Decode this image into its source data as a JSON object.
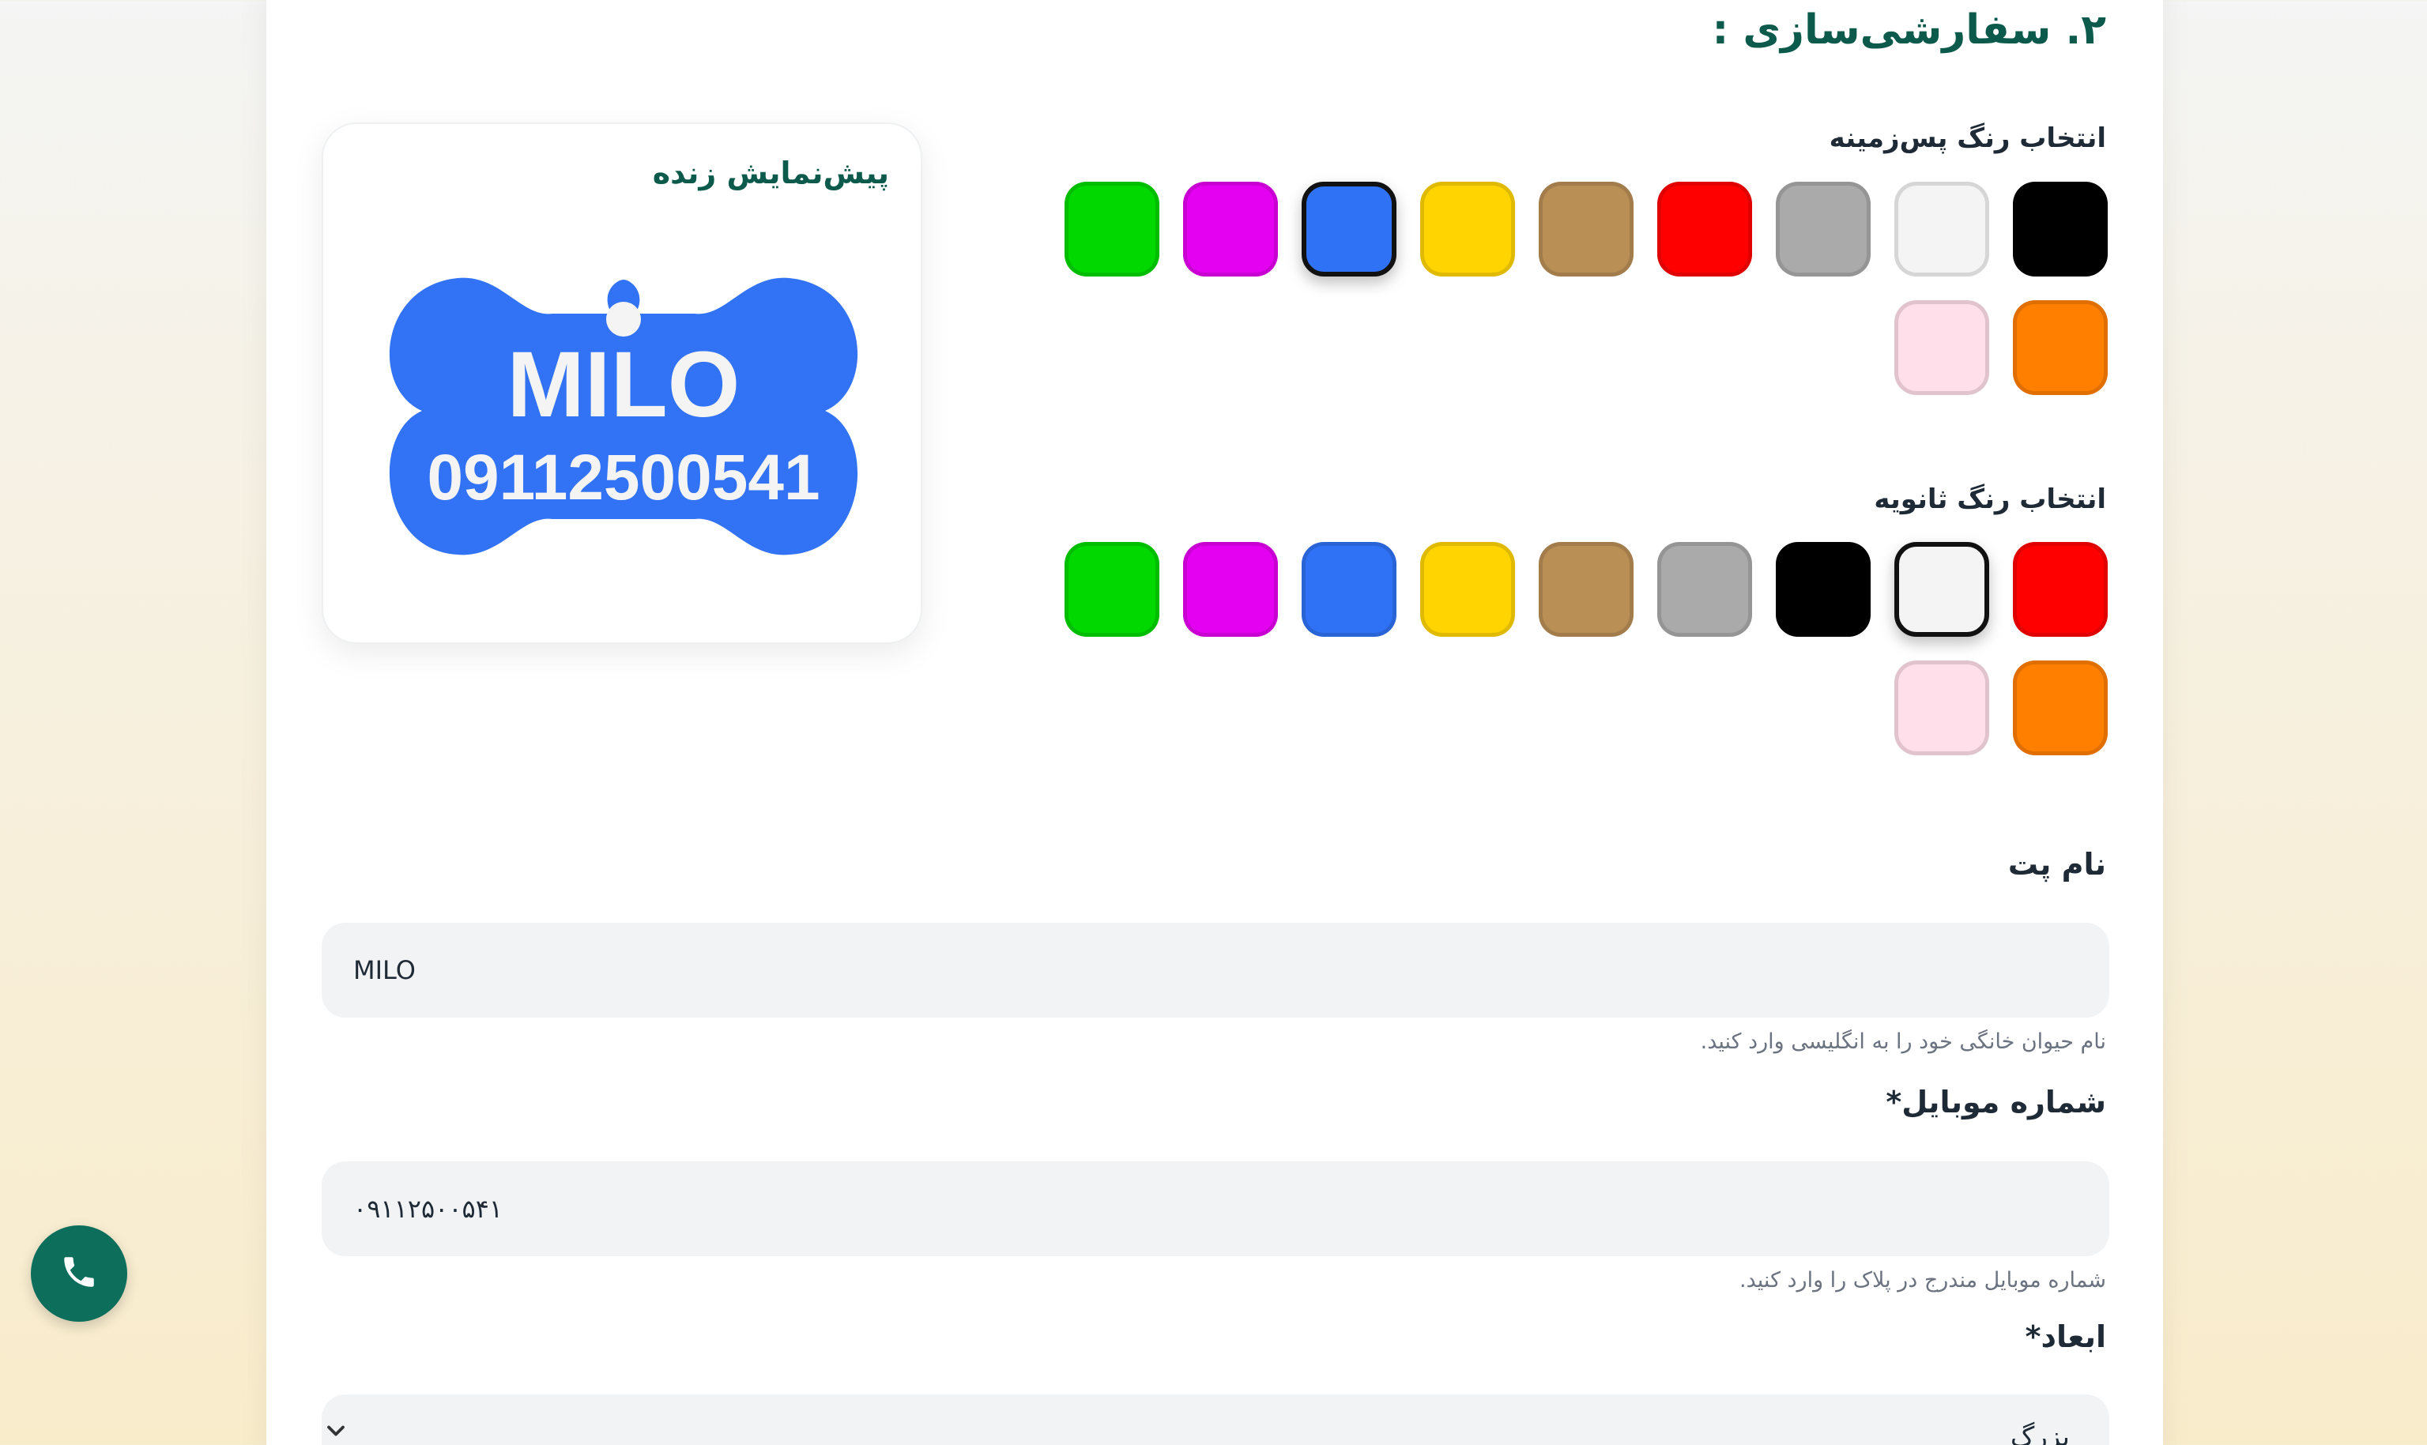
{
  "section": {
    "title": "۲. سفارشی‌سازی :"
  },
  "background_color": {
    "label": "انتخاب رنگ پس‌زمینه",
    "selected": "#2f72f5",
    "swatches": [
      "#000000",
      "#f4f4f4",
      "#aaaaaa",
      "#ff0000",
      "#b98f56",
      "#ffd400",
      "#2f72f5",
      "#e400f0",
      "#00d800",
      "#ff7f00",
      "#ffdfea"
    ]
  },
  "secondary_color": {
    "label": "انتخاب رنگ ثانویه",
    "selected": "#f4f4f4",
    "swatches": [
      "#ff0000",
      "#f4f4f4",
      "#000000",
      "#aaaaaa",
      "#b98f56",
      "#ffd400",
      "#2f72f5",
      "#e400f0",
      "#00d800",
      "#ff7f00",
      "#ffdfea"
    ]
  },
  "preview": {
    "title": "پیش‌نمایش زنده",
    "tag_name": "MILO",
    "tag_phone": "09112500541",
    "tag_color": "#3273f5",
    "text_color": "#f4f4f4"
  },
  "pet_name": {
    "label": "نام پت",
    "value": "MILO",
    "hint": "نام حیوان خانگی خود را به انگلیسی وارد کنید."
  },
  "mobile": {
    "label": "شماره موبایل*",
    "value": "۰۹۱۱۲۵۰۰۵۴۱",
    "hint": "شماره موبایل مندرج در پلاک را وارد کنید."
  },
  "dimensions": {
    "label": "ابعاد*",
    "value": "بزرگ"
  },
  "icons": {
    "call": "phone-icon",
    "select": "chevron-down-icon"
  }
}
